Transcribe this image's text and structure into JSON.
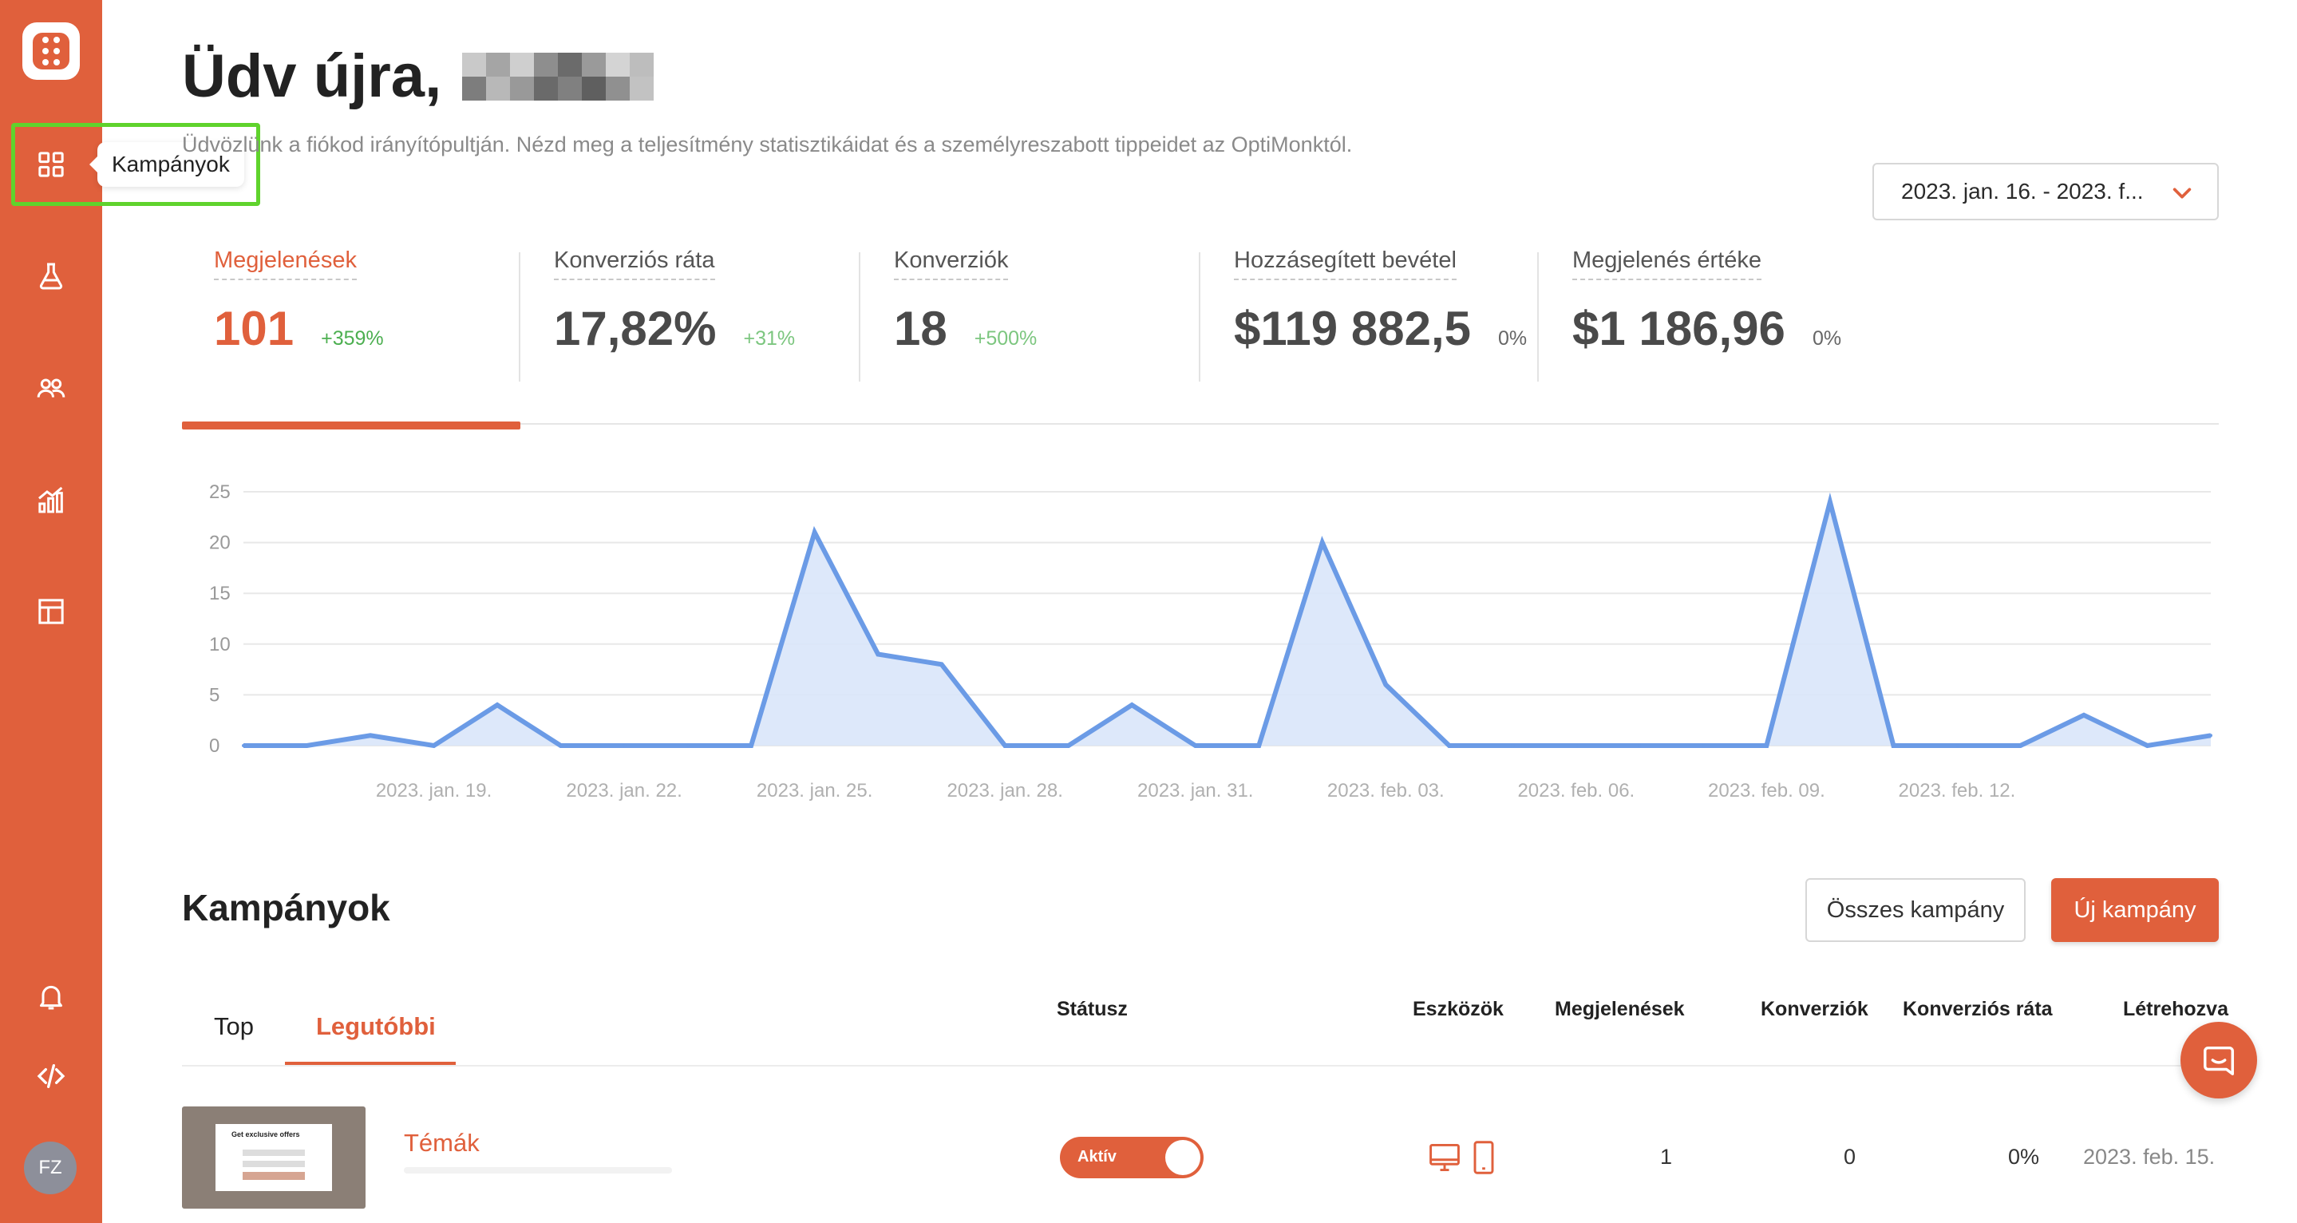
{
  "sidebar": {
    "nav": [
      {
        "name": "campaigns",
        "icon": "grid-icon"
      },
      {
        "name": "experiments",
        "icon": "flask-icon"
      },
      {
        "name": "subscribers",
        "icon": "users-icon"
      },
      {
        "name": "analytics",
        "icon": "chart-icon"
      },
      {
        "name": "templates",
        "icon": "layout-icon"
      },
      {
        "name": "notifications",
        "icon": "bell-icon"
      },
      {
        "name": "code",
        "icon": "code-icon"
      }
    ],
    "tooltip": "Kampányok",
    "avatar_initials": "FZ"
  },
  "header": {
    "greeting": "Üdv újra,",
    "subtitle": "Üdvözlünk a fiókod irányítópultján. Nézd meg a teljesítmény statisztikáidat és a személyreszabott tippeidet az OptiMonktól.",
    "date_range": "2023. jan. 16. - 2023. f..."
  },
  "kpis": [
    {
      "label": "Megjelenések",
      "value": "101",
      "change": "+359%",
      "active": true
    },
    {
      "label": "Konverziós ráta",
      "value": "17,82%",
      "change": "+31%"
    },
    {
      "label": "Konverziók",
      "value": "18",
      "change": "+500%"
    },
    {
      "label": "Hozzásegített bevétel",
      "value": "$119 882,5",
      "change": "0%"
    },
    {
      "label": "Megjelenés értéke",
      "value": "$1 186,96",
      "change": "0%"
    }
  ],
  "chart_data": {
    "type": "area",
    "series": [
      {
        "values": [
          0,
          0,
          1,
          0,
          4,
          0,
          0,
          0,
          0,
          21,
          9,
          8,
          0,
          0,
          4,
          0,
          0,
          20,
          6,
          0,
          0,
          0,
          0,
          0,
          0,
          24,
          0,
          0,
          0,
          3,
          0,
          1
        ]
      }
    ],
    "x_start_label": "2023. jan. 16.",
    "x_tick_labels": [
      "2023. jan. 19.",
      "2023. jan. 22.",
      "2023. jan. 25.",
      "2023. jan. 28.",
      "2023. jan. 31.",
      "2023. feb. 03.",
      "2023. feb. 06.",
      "2023. feb. 09.",
      "2023. feb. 12."
    ],
    "x_tick_indices": [
      3,
      6,
      9,
      12,
      15,
      18,
      21,
      24,
      27
    ],
    "y_ticks": [
      0,
      5,
      10,
      15,
      20,
      25
    ],
    "ylim": [
      0,
      25
    ],
    "grid": true,
    "line_color": "#6b9be6",
    "fill_color": "#d9e5f9"
  },
  "campaigns": {
    "title": "Kampányok",
    "all_button": "Összes kampány",
    "new_button": "Új kampány",
    "tabs": [
      "Top",
      "Legutóbbi"
    ],
    "columns": {
      "status": "Státusz",
      "devices": "Eszközök",
      "impressions": "Megjelenések",
      "conversions": "Konverziók",
      "conv_rate": "Konverziós ráta",
      "created": "Létrehozva"
    },
    "rows": [
      {
        "thumb_title": "Get exclusive offers",
        "name": "Témák",
        "status": "Aktív",
        "impressions": "1",
        "conversions": "0",
        "conv_rate": "0%",
        "created": "2023. feb. 15."
      }
    ]
  },
  "colors": {
    "brand": "#e0603c",
    "positive": "#4caf50",
    "highlight": "#5fd32c"
  }
}
